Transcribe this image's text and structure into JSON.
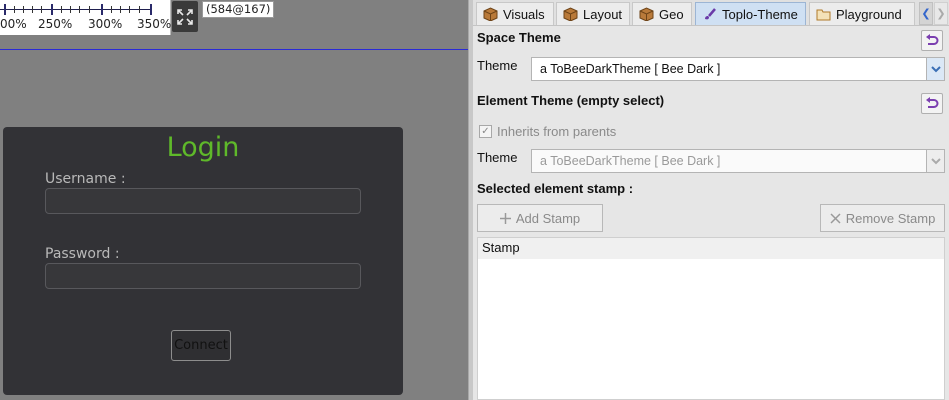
{
  "canvas": {
    "ruler_labels": [
      "00%",
      "250%",
      "300%",
      "350%"
    ],
    "coordinate_readout": "(584@167)",
    "icons": {
      "expand": "expand-arrows-icon"
    }
  },
  "login": {
    "title": "Login",
    "username_label": "Username :",
    "username_value": "",
    "password_label": "Password :",
    "password_value": "",
    "connect_label": "Connect",
    "colors": {
      "panel": "#323236",
      "title": "#5fb92a"
    }
  },
  "inspector": {
    "tabs": [
      {
        "label": "Visuals",
        "icon": "package-icon",
        "active": false
      },
      {
        "label": "Layout",
        "icon": "package-icon",
        "active": false
      },
      {
        "label": "Geo",
        "icon": "package-icon",
        "active": false
      },
      {
        "label": "Toplo-Theme",
        "icon": "brush-icon",
        "active": true
      },
      {
        "label": "Playground",
        "icon": "folder-icon",
        "active": false
      }
    ],
    "space_theme": {
      "heading": "Space Theme",
      "theme_label": "Theme",
      "theme_value": "a ToBeeDarkTheme [ Bee Dark ]"
    },
    "element_theme": {
      "heading": "Element Theme (empty select)",
      "inherits_label": "Inherits from parents",
      "inherits_checked": true,
      "theme_label": "Theme",
      "theme_value": "a ToBeeDarkTheme [ Bee Dark ]"
    },
    "stamps": {
      "heading": "Selected element stamp :",
      "add_label": "Add Stamp",
      "remove_label": "Remove Stamp",
      "column_header": "Stamp",
      "rows": []
    },
    "colors": {
      "active_tab": "#cfe0f3",
      "reset_icon": "#7b3fb0"
    }
  }
}
